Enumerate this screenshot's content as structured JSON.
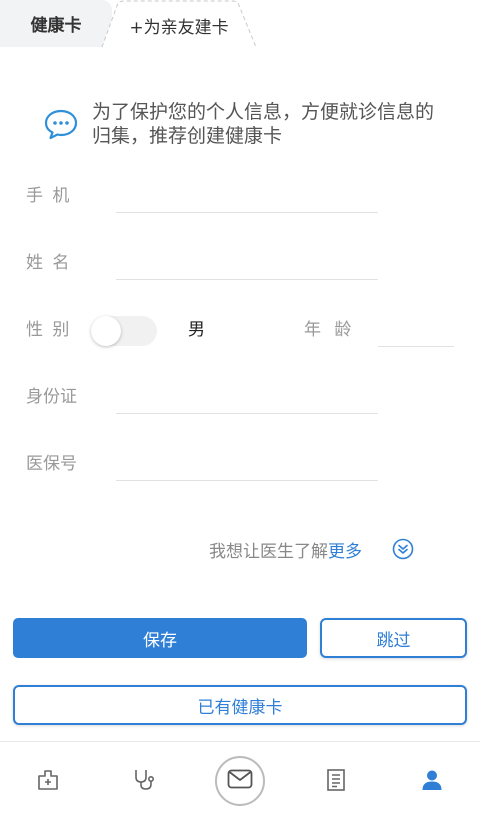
{
  "tabs": {
    "active": "健康卡",
    "inactive": "+为亲友建卡"
  },
  "notice": {
    "text": "为了保护您的个人信息，方便就诊信息的归集，推荐创建健康卡"
  },
  "form": {
    "phone_label": "手 机",
    "name_label": "姓 名",
    "gender_label": "性 别",
    "gender_value": "男",
    "age_label": "年 龄",
    "id_label": "身份证",
    "insurance_label": "医保号"
  },
  "more": {
    "prefix": "我想让医生了解",
    "link": "更多"
  },
  "buttons": {
    "save": "保存",
    "skip": "跳过",
    "have_card": "已有健康卡"
  },
  "colors": {
    "accent": "#2f7fd6",
    "active_nav": "#2f7fd6",
    "inactive_nav": "#666666"
  },
  "nav": {
    "items": [
      "hospital-icon",
      "stethoscope-icon",
      "mail-icon",
      "report-icon",
      "user-icon"
    ],
    "active_index": 4
  }
}
